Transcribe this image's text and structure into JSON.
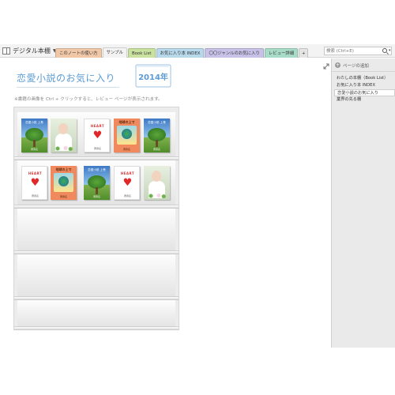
{
  "notebook": {
    "title": "デジタル本棚",
    "icon": "notebook-icon"
  },
  "tabs": [
    {
      "label": "このノートの使い方",
      "color": "#f0c8a8",
      "active": false
    },
    {
      "label": "サンプル",
      "color": "#f3f3f3",
      "active": true
    },
    {
      "label": "Book List",
      "color": "#c9e2a0",
      "active": false
    },
    {
      "label": "お気に入り本 INDEX",
      "color": "#b8d8ec",
      "active": false
    },
    {
      "label": "〇〇ジャンルのお気に入り",
      "color": "#c8c2e8",
      "active": false
    },
    {
      "label": "レビュー詳細",
      "color": "#a8dcc8",
      "active": false
    }
  ],
  "add_tab_label": "+",
  "search": {
    "placeholder": "検索 (Ctrl+E)"
  },
  "page": {
    "title": "恋愛小説のお気に入り",
    "year_tag": "2014年",
    "hint": "※書籍の画像を Ctrl + クリックすると、レビュー ページが表示されます。"
  },
  "books_row1": [
    {
      "style": "tree",
      "title": "恋愛小説 上巻",
      "author": "著者名"
    },
    {
      "style": "photo",
      "title": "",
      "author": ""
    },
    {
      "style": "heart",
      "title": "HEART",
      "author": "著者名"
    },
    {
      "style": "earth",
      "title": "地球の上で",
      "author": "著者名"
    },
    {
      "style": "tree",
      "title": "恋愛小説 上巻",
      "author": "著者名"
    }
  ],
  "books_row2": [
    {
      "style": "heart",
      "title": "HEART",
      "author": "著者名"
    },
    {
      "style": "earth",
      "title": "地球の上で",
      "author": "著者名"
    },
    {
      "style": "tree",
      "title": "恋愛小説 上巻",
      "author": "著者名"
    },
    {
      "style": "heart",
      "title": "HEART",
      "author": "著者名"
    },
    {
      "style": "photo",
      "title": "",
      "author": ""
    }
  ],
  "pages_pane": {
    "add_page_label": "ページの追加",
    "items": [
      {
        "label": "わたしの本棚（Book List）",
        "selected": false
      },
      {
        "label": "お気に入り本 INDEX",
        "selected": false
      },
      {
        "label": "恋愛小説のお気に入り",
        "selected": true
      },
      {
        "label": "業界の先る棚",
        "selected": false
      }
    ]
  }
}
